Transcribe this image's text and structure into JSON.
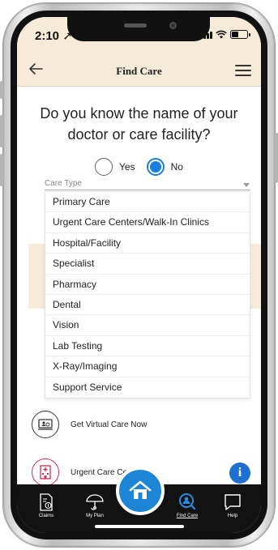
{
  "status_bar": {
    "time": "2:10 ➚"
  },
  "header": {
    "title": "Find Care",
    "back_icon": "arrow-left-icon",
    "menu_icon": "hamburger-menu-icon"
  },
  "question": {
    "text": "Do you know the name of your doctor or care facility?"
  },
  "radio": {
    "yes_label": "Yes",
    "no_label": "No",
    "selected": "No"
  },
  "care_type": {
    "label": "Care Type",
    "options": [
      "Primary Care",
      "Urgent Care Centers/Walk-In Clinics",
      "Hospital/Facility",
      "Specialist",
      "Pharmacy",
      "Dental",
      "Vision",
      "Lab Testing",
      "X-Ray/Imaging",
      "Support Service"
    ]
  },
  "actions": {
    "virtual_care": "Get Virtual Care Now",
    "urgent_care": "Urgent Care Centers"
  },
  "bottom_nav": {
    "claims": "Claims",
    "my_plan": "My Plan",
    "find_care": "Find Care",
    "help": "Help"
  },
  "colors": {
    "header_bg": "#f6ebd9",
    "accent_blue": "#1d85d6",
    "radio_blue": "#1a7fe0",
    "urgent_red": "#d12f55",
    "nav_bg": "#121212"
  }
}
